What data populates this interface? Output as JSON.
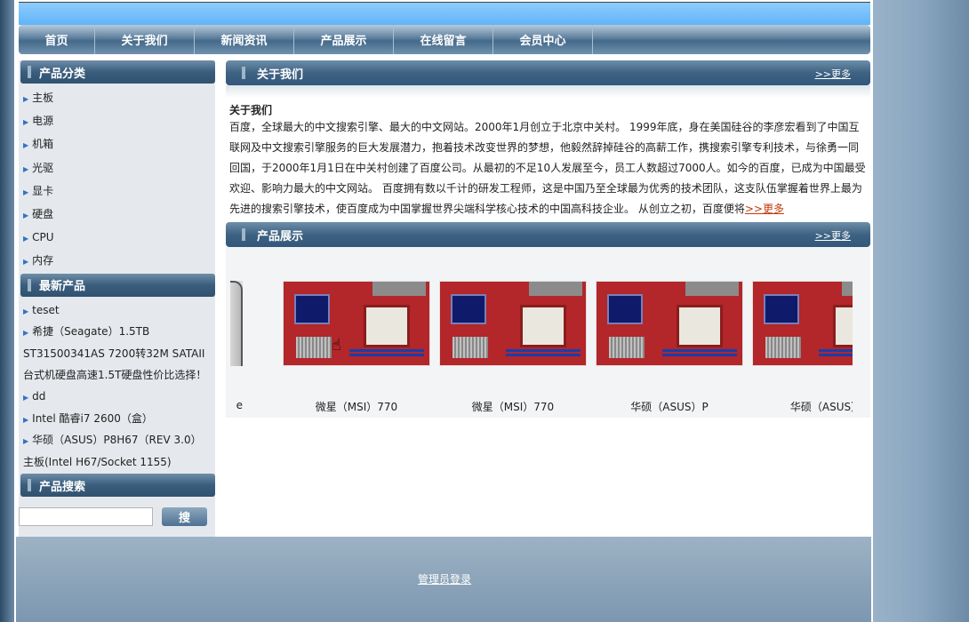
{
  "nav": {
    "items": [
      {
        "label": "首页"
      },
      {
        "label": "关于我们"
      },
      {
        "label": "新闻资讯"
      },
      {
        "label": "产品展示"
      },
      {
        "label": "在线留言"
      },
      {
        "label": "会员中心"
      }
    ]
  },
  "sidebar": {
    "categories": {
      "title": "产品分类",
      "items": [
        "主板",
        "电源",
        "机箱",
        "光驱",
        "显卡",
        "硬盘",
        "CPU",
        "内存"
      ]
    },
    "latest": {
      "title": "最新产品",
      "items": [
        "teset",
        "希捷（Seagate）1.5TB ST31500341AS 7200转32M SATAII 台式机硬盘高速1.5T硬盘性价比选择！",
        "dd",
        "Intel 酷睿i7 2600（盒）",
        "华硕（ASUS）P8H67（REV 3.0）主板(Intel H67/Socket 1155)"
      ]
    },
    "search": {
      "title": "产品搜索",
      "placeholder": "",
      "button": "搜"
    }
  },
  "about": {
    "header": "关于我们",
    "more": ">>更多",
    "title": "关于我们",
    "text": "百度，全球最大的中文搜索引擎、最大的中文网站。2000年1月创立于北京中关村。 1999年底，身在美国硅谷的李彦宏看到了中国互联网及中文搜索引擎服务的巨大发展潜力，抱着技术改变世界的梦想，他毅然辞掉硅谷的高薪工作，携搜索引擎专利技术，与徐勇一同回国，于2000年1月1日在中关村创建了百度公司。从最初的不足10人发展至今，员工人数超过7000人。如今的百度，已成为中国最受欢迎、影响力最大的中文网站。 百度拥有数以千计的研发工程师，这是中国乃至全球最为优秀的技术团队，这支队伍掌握着世界上最为先进的搜索引擎技术，使百度成为中国掌握世界尖端科学核心技术的中国高科技企业。 从创立之初，百度便将",
    "more_link": ">>更多"
  },
  "products": {
    "header": "产品展示",
    "more": ">>更多",
    "items": [
      {
        "name": "e"
      },
      {
        "name": "微星（MSI）770"
      },
      {
        "name": "微星（MSI）770"
      },
      {
        "name": "华硕（ASUS）P"
      },
      {
        "name": "华硕（ASUS）"
      }
    ]
  },
  "footer": {
    "admin_link": "管理员登录"
  }
}
